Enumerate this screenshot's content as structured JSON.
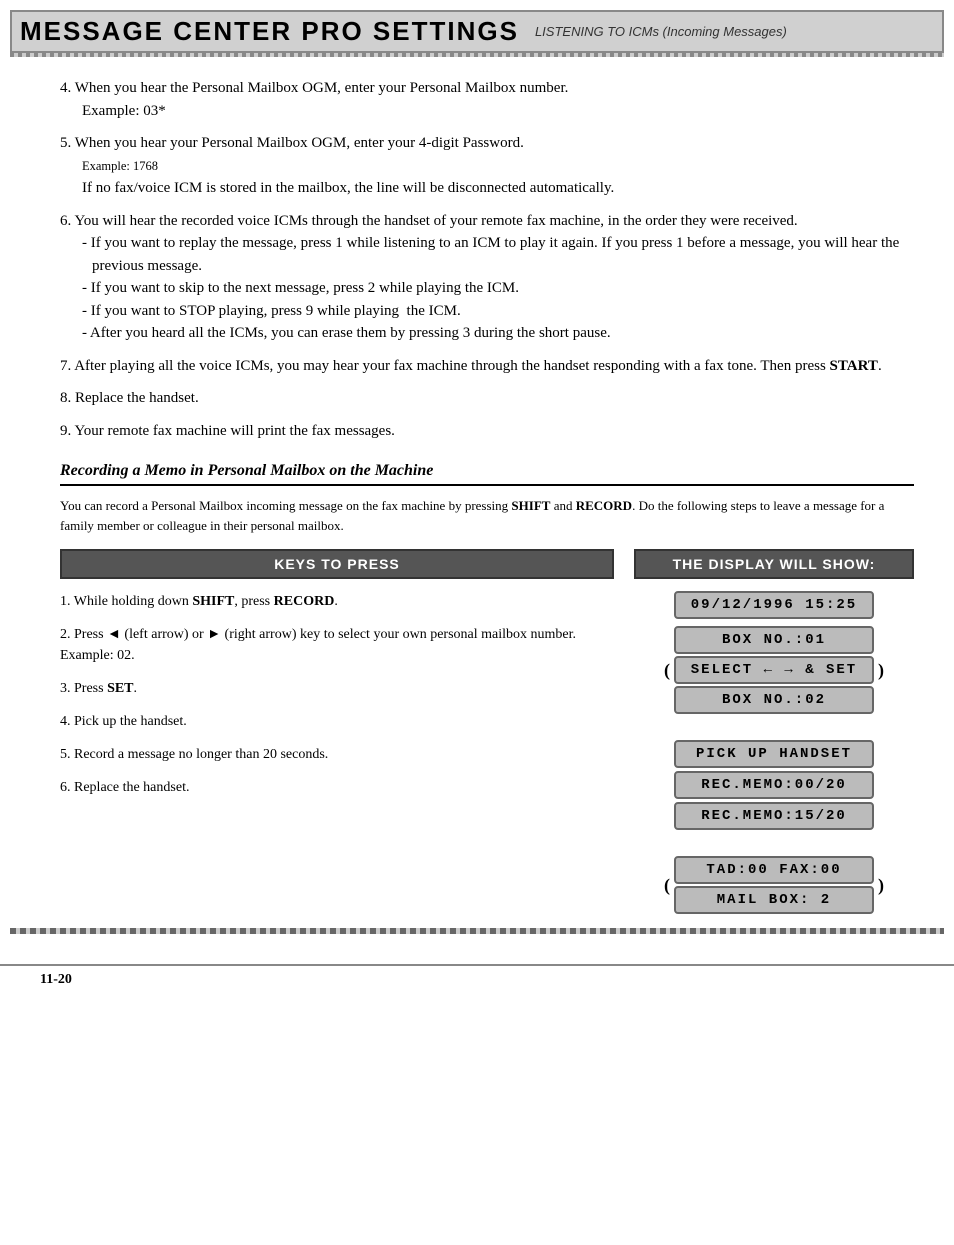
{
  "header": {
    "main_title": "MESSAGE CENTER PRO SETTINGS",
    "sub_title": "LISTENING TO ICMs (Incoming Messages)"
  },
  "numbered_items": [
    {
      "number": "4.",
      "text": "When you hear the Personal Mailbox OGM, enter your Personal Mailbox number.",
      "example": "Example: 03*"
    },
    {
      "number": "5.",
      "text": "When you hear your Personal Mailbox OGM, enter your 4-digit Password.",
      "example": "Example: 1768",
      "note": "If no fax/voice ICM is stored in the mailbox, the line will be disconnected automatically."
    },
    {
      "number": "6.",
      "text": "You will hear the recorded voice ICMs through the handset of your remote fax machine, in the order they were received.",
      "bullets": [
        "If you want to replay the message, press 1 while listening to an ICM to play it again. If you press 1 before a message, you will hear the previous message.",
        "If you want to skip to the next message, press 2 while playing the ICM.",
        "If you want to STOP playing, press 9 while playing  the ICM.",
        "After you heard all the ICMs, you can erase them by pressing 3 during the short pause."
      ]
    },
    {
      "number": "7.",
      "text": "After playing all the voice ICMs, you may hear your fax machine through the handset responding with a fax tone. Then press START."
    },
    {
      "number": "8.",
      "text": "Replace the handset."
    },
    {
      "number": "9.",
      "text": "Your remote fax machine will print the fax messages."
    }
  ],
  "section": {
    "heading": "Recording a Memo in Personal Mailbox on the Machine",
    "intro": "You can record a Personal Mailbox incoming message on the fax machine by pressing SHIFT and RECORD. Do the following steps to leave a message for a family member or colleague in their personal mailbox."
  },
  "left_col_header": "KEYS TO PRESS",
  "right_col_header": "THE DISPLAY WILL SHOW:",
  "steps": [
    {
      "number": "1.",
      "text": "While holding down SHIFT, press RECORD."
    },
    {
      "number": "2.",
      "text": "Press ◄ (left arrow) or ► (right arrow) key to select your own personal mailbox number. Example: 02."
    },
    {
      "number": "3.",
      "text": "Press SET."
    },
    {
      "number": "4.",
      "text": "Pick up the handset."
    },
    {
      "number": "5.",
      "text": "Record a message no longer than 20 seconds."
    },
    {
      "number": "6.",
      "text": "Replace the handset."
    }
  ],
  "displays": {
    "date_time": "09/12/1996  15:25",
    "box_no_01": "BOX NO.:01",
    "select": "SELECT  ←  →  &  SET",
    "box_no_02": "BOX NO.:02",
    "pick_up": "PICK UP HANDSET",
    "rec_memo_1": "REC.MEMO:00/20",
    "rec_memo_2": "REC.MEMO:15/20",
    "tad_fax": "TAD:00  FAX:00",
    "mail_box": "MAIL BOX: 2"
  },
  "footer": {
    "page": "11-20"
  }
}
